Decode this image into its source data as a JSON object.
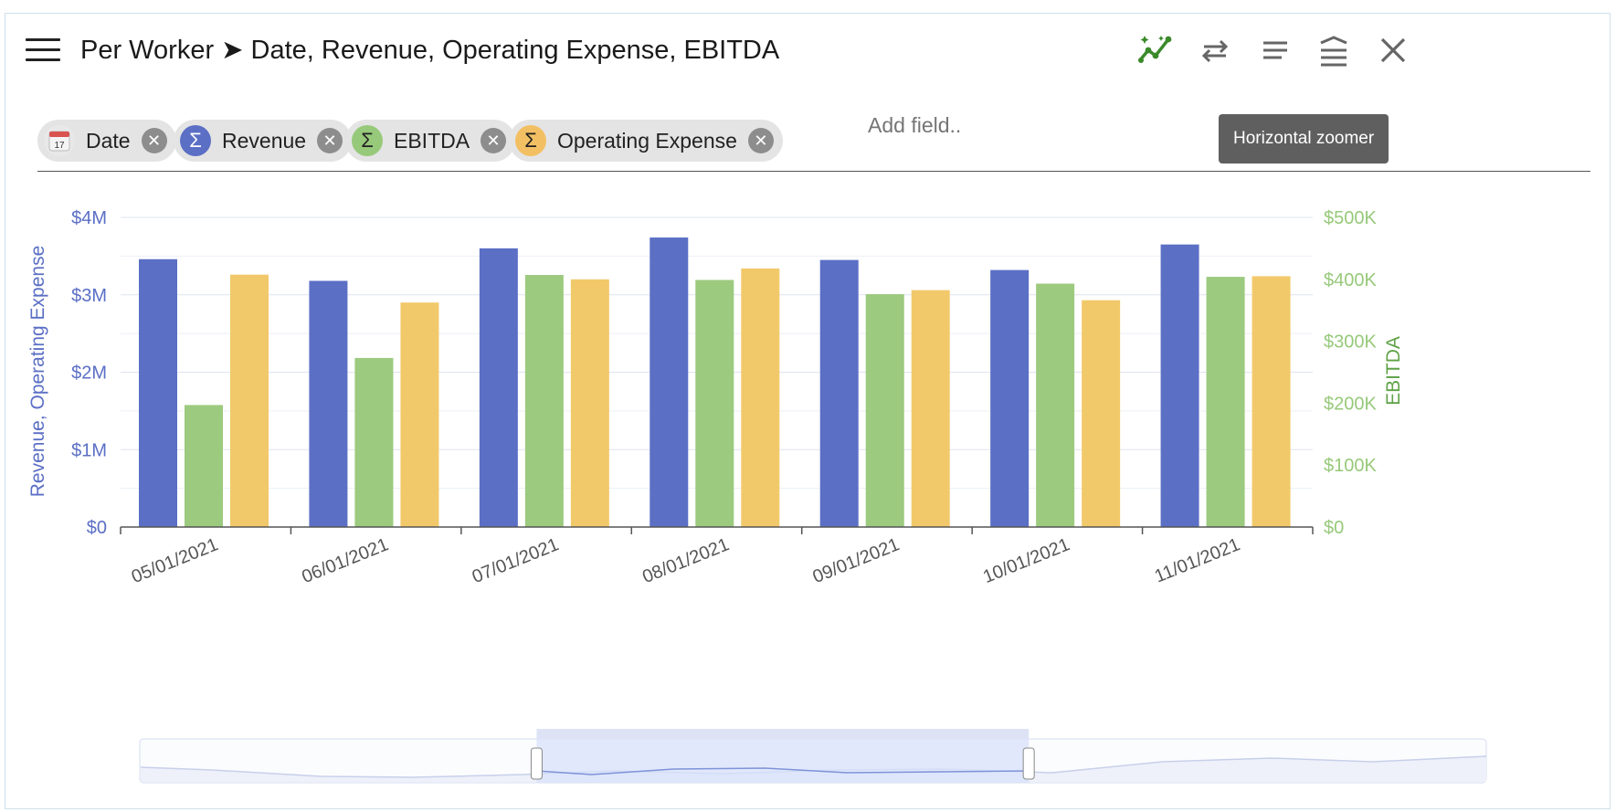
{
  "header": {
    "title": "Per Worker ➤ Date, Revenue, Operating Expense, EBITDA",
    "tooltip": "Horizontal zoomer"
  },
  "toolbar": {
    "icons": [
      "menu-icon",
      "smart-line-icon",
      "swap-icon",
      "align-icon",
      "collapse-icon",
      "close-icon"
    ],
    "accent_color": "#3a8a2a"
  },
  "fields": {
    "chips": [
      {
        "label": "Date",
        "icon": "calendar-icon",
        "icon_text": "17",
        "color": "#e0e0e0"
      },
      {
        "label": "Revenue",
        "icon": "sigma-icon",
        "icon_text": "Σ",
        "color": "#5b6fc5"
      },
      {
        "label": "EBITDA",
        "icon": "sigma-icon",
        "icon_text": "Σ",
        "color": "#97c97a"
      },
      {
        "label": "Operating Expense",
        "icon": "sigma-icon",
        "icon_text": "Σ",
        "color": "#f2c063"
      }
    ],
    "add_placeholder": "Add field.."
  },
  "chart_data": {
    "type": "bar",
    "categories": [
      "05/01/2021",
      "06/01/2021",
      "07/01/2021",
      "08/01/2021",
      "09/01/2021",
      "10/01/2021",
      "11/01/2021"
    ],
    "series": [
      {
        "name": "Revenue",
        "axis": "left",
        "color": "#5b6fc5",
        "values": [
          3460000,
          3180000,
          3600000,
          3740000,
          3450000,
          3320000,
          3650000
        ]
      },
      {
        "name": "EBITDA",
        "axis": "right",
        "color": "#9cca7e",
        "values": [
          197000,
          273000,
          407000,
          399000,
          376000,
          393000,
          404000
        ]
      },
      {
        "name": "Operating Expense",
        "axis": "left",
        "color": "#f2c96a",
        "values": [
          3260000,
          2900000,
          3200000,
          3340000,
          3060000,
          2930000,
          3240000
        ]
      }
    ],
    "ylabel": "Revenue, Operating Expense",
    "ylabel_right": "EBITDA",
    "ylim": [
      0,
      4000000
    ],
    "ylim_right": [
      0,
      500000
    ],
    "yticks": [
      "$0",
      "$1M",
      "$2M",
      "$3M",
      "$4M"
    ],
    "yticks_right": [
      "$0",
      "$100K",
      "$200K",
      "$300K",
      "$400K",
      "$500K"
    ],
    "left_axis_color": "#5b6fc5",
    "right_axis_color": "#97c97a",
    "grid": true
  },
  "zoomer": {
    "selection_range": [
      0.295,
      0.66
    ]
  }
}
